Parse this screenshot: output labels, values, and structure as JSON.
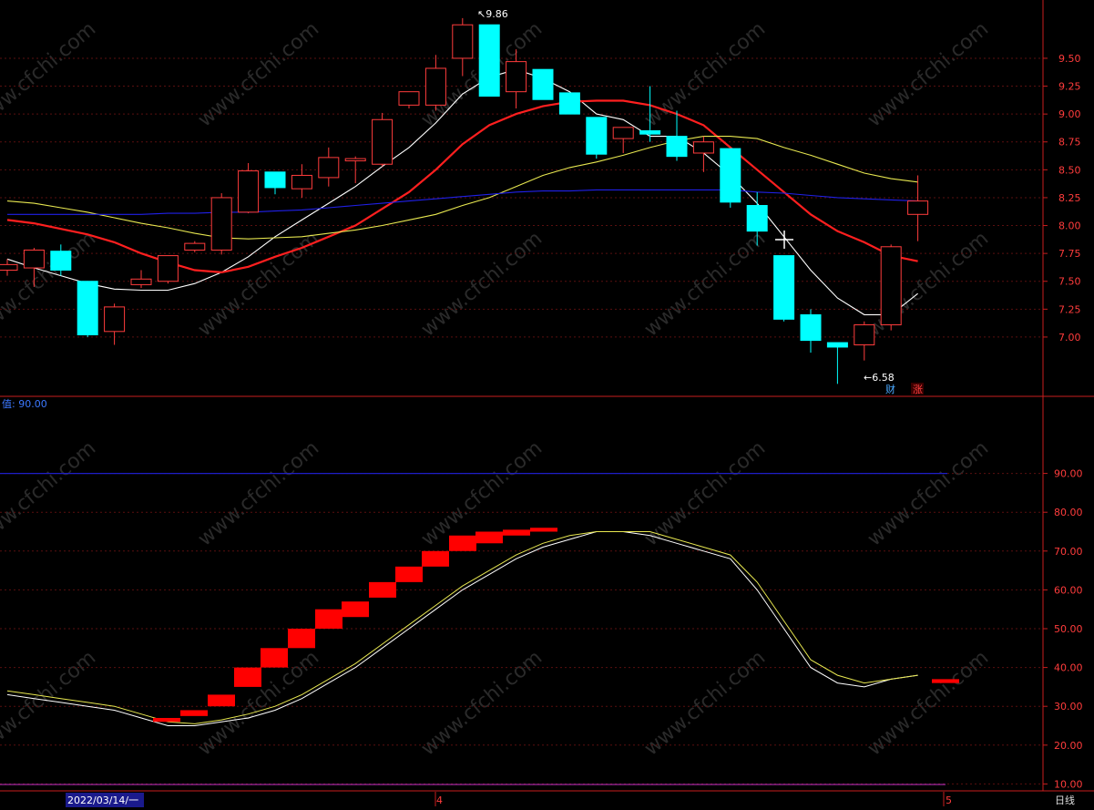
{
  "chart_data": [
    {
      "type": "candlestick",
      "ylim": [
        6.55,
        9.9
      ],
      "yticks": [
        "9.50",
        "9.25",
        "9.00",
        "8.75",
        "8.50",
        "8.25",
        "8.00",
        "7.75",
        "7.50",
        "7.25",
        "7.00"
      ],
      "high_label": "9.86",
      "low_label": "6.58",
      "markers": [
        "财",
        "涨"
      ],
      "grid": true,
      "candles": [
        {
          "o": 7.6,
          "h": 7.7,
          "c": 7.65,
          "l": 7.55
        },
        {
          "o": 7.62,
          "h": 7.8,
          "c": 7.78,
          "l": 7.45
        },
        {
          "o": 7.77,
          "h": 7.83,
          "c": 7.6,
          "l": 7.55
        },
        {
          "o": 7.5,
          "h": 7.5,
          "c": 7.02,
          "l": 7.0
        },
        {
          "o": 7.05,
          "h": 7.3,
          "c": 7.27,
          "l": 6.93
        },
        {
          "o": 7.47,
          "h": 7.6,
          "c": 7.52,
          "l": 7.44
        },
        {
          "o": 7.5,
          "h": 7.73,
          "c": 7.73,
          "l": 7.48
        },
        {
          "o": 7.78,
          "h": 7.86,
          "c": 7.84,
          "l": 7.76
        },
        {
          "o": 7.78,
          "h": 8.29,
          "c": 8.25,
          "l": 7.74
        },
        {
          "o": 8.12,
          "h": 8.56,
          "c": 8.49,
          "l": 8.11
        },
        {
          "o": 8.48,
          "h": 8.48,
          "c": 8.34,
          "l": 8.28
        },
        {
          "o": 8.33,
          "h": 8.55,
          "c": 8.45,
          "l": 8.25
        },
        {
          "o": 8.43,
          "h": 8.7,
          "c": 8.61,
          "l": 8.35
        },
        {
          "o": 8.58,
          "h": 8.62,
          "c": 8.6,
          "l": 8.38
        },
        {
          "o": 8.55,
          "h": 9.01,
          "c": 8.95,
          "l": 8.53
        },
        {
          "o": 9.08,
          "h": 9.16,
          "c": 9.2,
          "l": 9.05
        },
        {
          "o": 9.08,
          "h": 9.53,
          "c": 9.41,
          "l": 9.03
        },
        {
          "o": 9.5,
          "h": 9.86,
          "c": 9.8,
          "l": 9.34
        },
        {
          "o": 9.8,
          "h": 9.8,
          "c": 9.16,
          "l": 9.16
        },
        {
          "o": 9.2,
          "h": 9.58,
          "c": 9.47,
          "l": 9.05
        },
        {
          "o": 9.4,
          "h": 9.4,
          "c": 9.13,
          "l": 9.13
        },
        {
          "o": 9.19,
          "h": 9.19,
          "c": 9.0,
          "l": 9.0
        },
        {
          "o": 8.97,
          "h": 8.97,
          "c": 8.64,
          "l": 8.6
        },
        {
          "o": 8.78,
          "h": 8.88,
          "c": 8.88,
          "l": 8.65
        },
        {
          "o": 8.85,
          "h": 9.25,
          "c": 8.82,
          "l": 8.75
        },
        {
          "o": 8.8,
          "h": 9.03,
          "c": 8.62,
          "l": 8.58
        },
        {
          "o": 8.65,
          "h": 8.8,
          "c": 8.75,
          "l": 8.48
        },
        {
          "o": 8.69,
          "h": 8.69,
          "c": 8.21,
          "l": 8.16
        },
        {
          "o": 8.18,
          "h": 8.3,
          "c": 7.95,
          "l": 7.82
        },
        {
          "o": 7.73,
          "h": 7.73,
          "c": 7.16,
          "l": 7.14
        },
        {
          "o": 7.2,
          "h": 7.25,
          "c": 6.97,
          "l": 6.86
        },
        {
          "o": 6.95,
          "h": 6.95,
          "c": 6.91,
          "l": 6.58
        },
        {
          "o": 6.93,
          "h": 7.14,
          "c": 7.11,
          "l": 6.79
        },
        {
          "o": 7.11,
          "h": 7.83,
          "c": 7.81,
          "l": 7.06
        },
        {
          "o": 8.1,
          "h": 8.45,
          "c": 8.22,
          "l": 7.86
        }
      ],
      "series": [
        {
          "color": "#ffffff",
          "values": [
            7.7,
            7.62,
            7.55,
            7.48,
            7.43,
            7.42,
            7.42,
            7.48,
            7.58,
            7.72,
            7.9,
            8.05,
            8.2,
            8.35,
            8.53,
            8.7,
            8.92,
            9.18,
            9.33,
            9.4,
            9.32,
            9.2,
            9.0,
            8.95,
            8.8,
            8.8,
            8.65,
            8.45,
            8.2,
            7.9,
            7.6,
            7.35,
            7.2,
            7.2,
            7.39
          ]
        },
        {
          "color": "#ff1f1f",
          "values": [
            8.05,
            8.02,
            7.97,
            7.92,
            7.85,
            7.75,
            7.67,
            7.6,
            7.58,
            7.63,
            7.72,
            7.8,
            7.9,
            8.0,
            8.15,
            8.3,
            8.5,
            8.73,
            8.9,
            9.0,
            9.07,
            9.11,
            9.12,
            9.12,
            9.08,
            9.0,
            8.9,
            8.7,
            8.5,
            8.3,
            8.1,
            7.95,
            7.85,
            7.73,
            7.68
          ]
        },
        {
          "color": "#e8e850",
          "values": [
            8.22,
            8.2,
            8.16,
            8.12,
            8.07,
            8.02,
            7.98,
            7.93,
            7.89,
            7.88,
            7.89,
            7.9,
            7.93,
            7.96,
            8.0,
            8.05,
            8.1,
            8.18,
            8.25,
            8.35,
            8.45,
            8.52,
            8.57,
            8.63,
            8.7,
            8.76,
            8.8,
            8.8,
            8.78,
            8.7,
            8.63,
            8.55,
            8.47,
            8.42,
            8.39
          ]
        },
        {
          "color": "#2020e8",
          "values": [
            8.1,
            8.1,
            8.1,
            8.1,
            8.1,
            8.1,
            8.11,
            8.11,
            8.12,
            8.12,
            8.13,
            8.14,
            8.16,
            8.18,
            8.2,
            8.22,
            8.24,
            8.26,
            8.28,
            8.3,
            8.31,
            8.31,
            8.32,
            8.32,
            8.32,
            8.32,
            8.32,
            8.32,
            8.3,
            8.29,
            8.27,
            8.25,
            8.24,
            8.23,
            8.22
          ]
        }
      ]
    },
    {
      "type": "line",
      "title": "值: 90.00",
      "ylim": [
        0,
        100
      ],
      "yticks": [
        "90.00",
        "80.00",
        "70.00",
        "60.00",
        "50.00",
        "40.00",
        "30.00",
        "20.00",
        "10.00"
      ],
      "reference_line": 90,
      "grid": true,
      "series": [
        {
          "color": "#ffffff",
          "values": [
            33,
            32,
            31,
            30,
            29,
            27,
            25,
            25,
            26,
            27,
            29,
            32,
            36,
            40,
            45,
            50,
            55,
            60,
            64,
            68,
            71,
            73,
            75,
            75,
            74,
            72,
            70,
            68,
            60,
            50,
            40,
            36,
            35,
            37,
            38
          ]
        },
        {
          "color": "#e8e850",
          "values": [
            34,
            33,
            32,
            31,
            30,
            28,
            26,
            25.5,
            26.5,
            28,
            30,
            33,
            37,
            41,
            46,
            51,
            56,
            61,
            65,
            69,
            72,
            74,
            75,
            75,
            75,
            73,
            71,
            69,
            62,
            52,
            42,
            38,
            36,
            37,
            38
          ]
        }
      ],
      "blocks": [
        {
          "from": 26,
          "to": 27
        },
        {
          "from": 27.5,
          "to": 29
        },
        {
          "from": 30,
          "to": 33
        },
        {
          "from": 35,
          "to": 40
        },
        {
          "from": 40,
          "to": 45
        },
        {
          "from": 45,
          "to": 50
        },
        {
          "from": 50,
          "to": 55
        },
        {
          "from": 53,
          "to": 57
        },
        {
          "from": 58,
          "to": 62
        },
        {
          "from": 62,
          "to": 66
        },
        {
          "from": 66,
          "to": 70
        },
        {
          "from": 70,
          "to": 74
        },
        {
          "from": 72,
          "to": 75
        },
        {
          "from": 74,
          "to": 75.5
        },
        {
          "from": 75,
          "to": 76
        },
        {
          "from": 36,
          "to": 37
        }
      ]
    }
  ],
  "bottom_bar": {
    "date_label": "2022/03/14/一",
    "month_marks": [
      "4",
      "5"
    ],
    "period_label": "日线"
  },
  "watermark": "www.cfchi.com"
}
